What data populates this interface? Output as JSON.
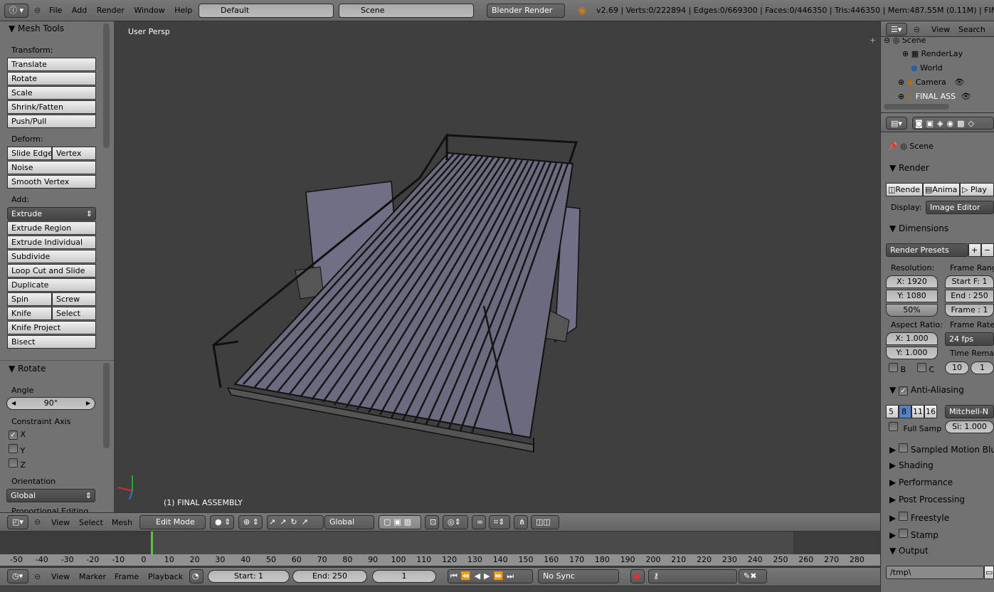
{
  "topbar": {
    "menus": [
      "File",
      "Add",
      "Render",
      "Window",
      "Help"
    ],
    "layout": "Default",
    "scene": "Scene",
    "engine": "Blender Render",
    "stats": "v2.69 | Verts:0/222894 | Edges:0/669300 | Faces:0/446350 | Tris:446350 | Mem:487.55M (0.11M) | FINAL AS"
  },
  "tools": {
    "title": "Mesh Tools",
    "transform_label": "Transform:",
    "transform": [
      "Translate",
      "Rotate",
      "Scale",
      "Shrink/Fatten",
      "Push/Pull"
    ],
    "deform_label": "Deform:",
    "slide_edge": "Slide Edge",
    "vertex": "Vertex",
    "noise": "Noise",
    "smooth_vertex": "Smooth Vertex",
    "add_label": "Add:",
    "extrude": "Extrude",
    "add": [
      "Extrude Region",
      "Extrude Individual",
      "Subdivide",
      "Loop Cut and Slide",
      "Duplicate"
    ],
    "spin": "Spin",
    "screw": "Screw",
    "knife": "Knife",
    "select": "Select",
    "knife_project": "Knife Project",
    "bisect": "Bisect"
  },
  "op": {
    "title": "Rotate",
    "angle_label": "Angle",
    "angle": "90°",
    "axis_label": "Constraint Axis",
    "x": "X",
    "y": "Y",
    "z": "Z",
    "orient_label": "Orientation",
    "orient": "Global",
    "prop": "Proportional Editing"
  },
  "viewport": {
    "persp": "User Persp",
    "object": "(1) FINAL ASSEMBLY"
  },
  "v3dheader": {
    "view": "View",
    "select": "Select",
    "mesh": "Mesh",
    "mode": "Edit Mode",
    "orient": "Global"
  },
  "timeline": {
    "ticks": [
      "-50",
      "-40",
      "-30",
      "-20",
      "-10",
      "0",
      "10",
      "20",
      "30",
      "40",
      "50",
      "60",
      "70",
      "80",
      "90",
      "100",
      "110",
      "120",
      "130",
      "140",
      "150",
      "160",
      "170",
      "180",
      "190",
      "200",
      "210",
      "220",
      "230",
      "240",
      "250",
      "260",
      "270",
      "280"
    ],
    "view": "View",
    "marker": "Marker",
    "frame": "Frame",
    "playback": "Playback",
    "start": "Start: 1",
    "end": "End: 250",
    "current": "1",
    "sync": "No Sync"
  },
  "outliner": {
    "view": "View",
    "search": "Search",
    "items": [
      "Scene",
      "RenderLay",
      "World",
      "Camera",
      "FINAL ASS"
    ]
  },
  "props": {
    "scene": "Scene",
    "render": "Render",
    "rende": "Rende",
    "anima": "Anima",
    "play": "Play",
    "display_label": "Display:",
    "display": "Image Editor",
    "dimensions": "Dimensions",
    "presets": "Render Presets",
    "res_label": "Resolution:",
    "resx": "X: 1920",
    "resy": "Y: 1080",
    "pct": "50%",
    "fr_label": "Frame Range",
    "startf": "Start F: 1",
    "end": "End : 250",
    "frame": "Frame : 1",
    "aspect_label": "Aspect Ratio:",
    "ax": "X: 1.000",
    "ay": "Y: 1.000",
    "rate_label": "Frame Rate:",
    "fps": "24 fps",
    "remap_label": "Time Remap",
    "remap1": "10",
    "remap2": "1",
    "b": "B",
    "c": "C",
    "aa": "Anti-Aliasing",
    "aa_vals": [
      "5",
      "8",
      "11",
      "16"
    ],
    "filter": "Mitchell-N",
    "fullsamp": "Full Samp",
    "size": "Si: 1.000",
    "panels": [
      "Sampled Motion Blur",
      "Shading",
      "Performance",
      "Post Processing",
      "Freestyle",
      "Stamp",
      "Output"
    ],
    "output_path": "/tmp\\"
  }
}
